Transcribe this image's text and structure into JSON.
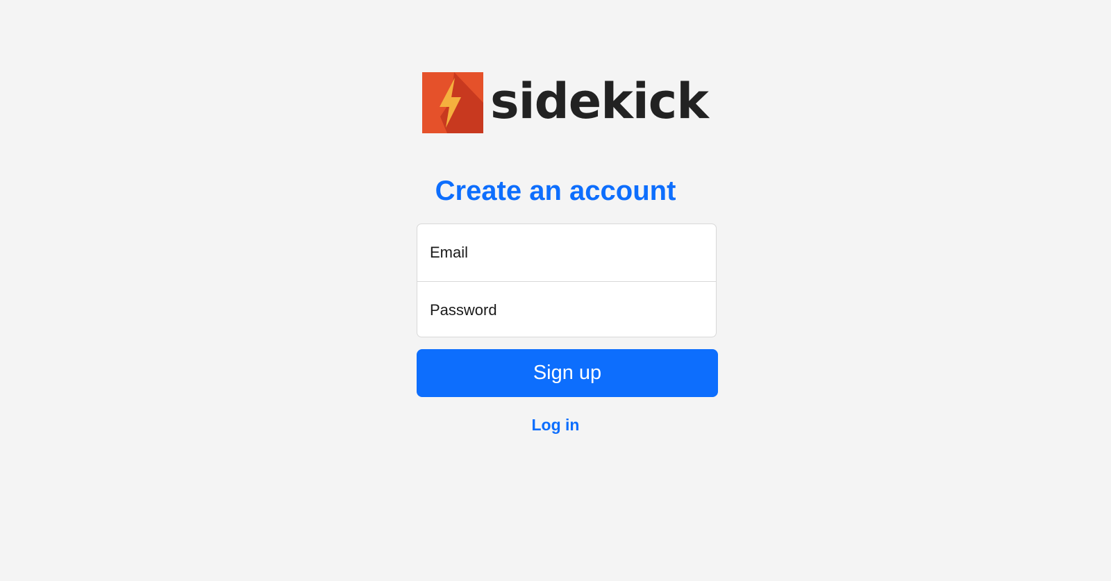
{
  "brand": {
    "name": "sidekick",
    "icon": "lightning-bolt-icon",
    "colors": {
      "tile": "#e5512a",
      "tile_shadow": "#c8391f",
      "bolt": "#f5b03e"
    }
  },
  "form": {
    "title": "Create an account",
    "email_placeholder": "Email",
    "password_placeholder": "Password",
    "submit_label": "Sign up",
    "alt_link_label": "Log in"
  },
  "colors": {
    "accent": "#0d6efd",
    "background": "#f4f4f4"
  }
}
